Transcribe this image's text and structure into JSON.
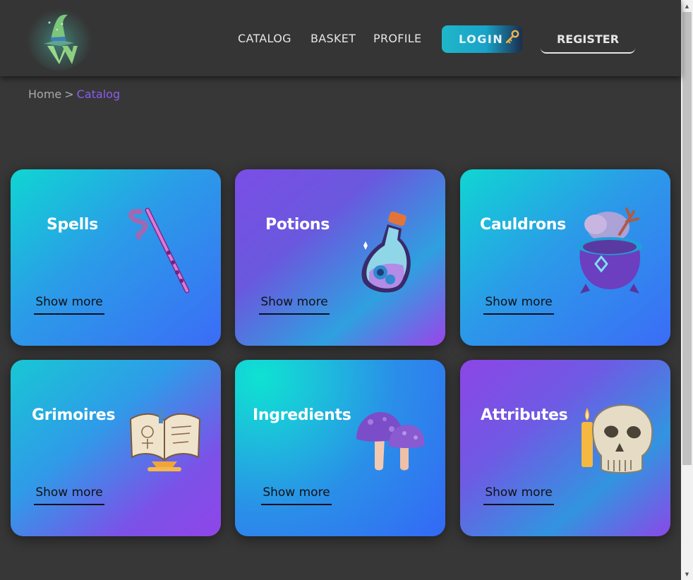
{
  "header": {
    "logo_icon": "wizard-hat-w-logo",
    "nav": [
      "CATALOG",
      "BASKET",
      "PROFILE"
    ],
    "login_label": "LOGIN",
    "login_icon": "key-icon",
    "register_label": "REGISTER"
  },
  "breadcrumb": {
    "home": "Home",
    "separator": ">",
    "current": "Catalog"
  },
  "cards": [
    {
      "title": "Spells",
      "action": "Show more",
      "icon": "magic-wand-icon"
    },
    {
      "title": "Potions",
      "action": "Show more",
      "icon": "potion-bottle-icon"
    },
    {
      "title": "Cauldrons",
      "action": "Show more",
      "icon": "cauldron-icon"
    },
    {
      "title": "Grimoires",
      "action": "Show more",
      "icon": "open-book-icon"
    },
    {
      "title": "Ingredients",
      "action": "Show more",
      "icon": "mushroom-icon"
    },
    {
      "title": "Attributes",
      "action": "Show more",
      "icon": "skull-candle-icon"
    }
  ],
  "colors": {
    "background": "#373737",
    "header": "#353535",
    "accent_purple": "#8a5cf0",
    "login_teal": "#1fb6c9"
  }
}
